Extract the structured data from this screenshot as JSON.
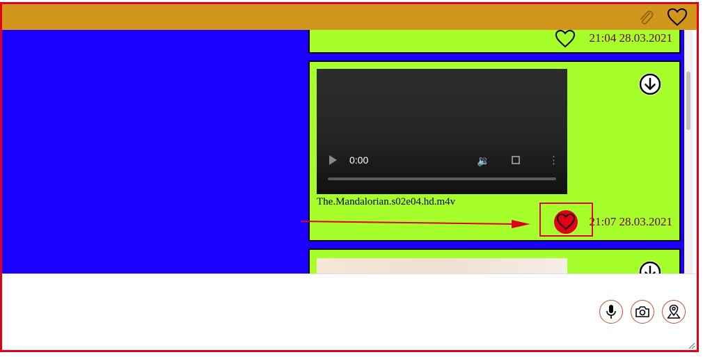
{
  "messages": [
    {
      "time": "21:04 28.03.2021"
    },
    {
      "filename": "The.Mandalorian.s02e04.hd.m4v",
      "video_time": "0:00",
      "time": "21:07 28.03.2021"
    },
    {}
  ],
  "icons": {
    "topbar": [
      "paperclip-icon",
      "heart-icon"
    ],
    "composer": [
      "microphone-icon",
      "camera-icon",
      "location-icon"
    ]
  },
  "colors": {
    "topbar": "#d3961c",
    "pane": "#1a00ff",
    "card": "#a6ff2a",
    "timestamp": "#6a0018",
    "annotation": "#e00018"
  }
}
